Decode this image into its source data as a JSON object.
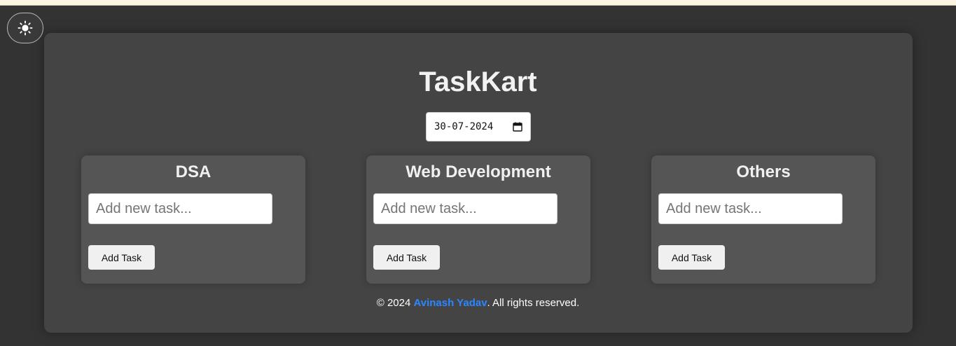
{
  "app": {
    "title": "TaskKart"
  },
  "theme_toggle": {
    "icon": "sun-icon"
  },
  "date_picker": {
    "value": "30-07-2024",
    "icon": "calendar-icon"
  },
  "categories": [
    {
      "title": "DSA",
      "input_placeholder": "Add new task...",
      "button_label": "Add Task"
    },
    {
      "title": "Web Development",
      "input_placeholder": "Add new task...",
      "button_label": "Add Task"
    },
    {
      "title": "Others",
      "input_placeholder": "Add new task...",
      "button_label": "Add Task"
    }
  ],
  "footer": {
    "prefix": "© 2024 ",
    "author": "Avinash Yadav",
    "suffix": ". All rights reserved."
  },
  "colors": {
    "background": "#333333",
    "panel": "#444444",
    "card": "#555555",
    "link": "#2b87ff",
    "top_strip": "#fdf3e1"
  }
}
